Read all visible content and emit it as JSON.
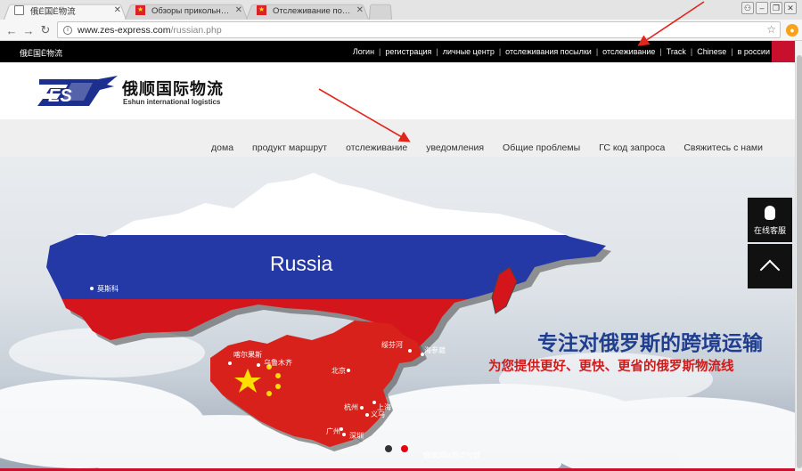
{
  "browser": {
    "tabs": [
      {
        "title": "俄Ё国Ё物流",
        "favicon": "page-icon",
        "active": true
      },
      {
        "title": "Обзоры прикольных и нео",
        "favicon": "vietnam-flag-icon",
        "active": false
      },
      {
        "title": "Отслеживание посылок и",
        "favicon": "vietnam-flag-icon",
        "active": false
      }
    ],
    "url_host": "www.zes-express.com",
    "url_path": "/russian.php"
  },
  "topbar": {
    "brand": "俄Ё国Ё物流",
    "links": [
      "Логин",
      "регистрация",
      "личные центр",
      "отслеживания посылки",
      "отслеживание",
      "Track",
      "Chinese",
      "в россии"
    ]
  },
  "logo": {
    "cn": "俄顺国际物流",
    "en": "Eshun international logistics",
    "mark": "ES"
  },
  "nav": {
    "items": [
      "дома",
      "продукт маршрут",
      "отслеживание",
      "уведомления",
      "Общие проблемы",
      "ГС код запроса",
      "Свяжитесь с нами"
    ]
  },
  "hero": {
    "russia_label": "Russia",
    "cities": {
      "moscow": "莫斯科",
      "urumqi": "乌鲁木齐",
      "xinjiang": "喀尔果斯",
      "suifenhe": "绥芬河",
      "beijing": "北京",
      "shanghai": "上海",
      "hangzhou": "杭州",
      "yiwu": "义乌",
      "guangzhou": "广州",
      "shenzhen": "深圳",
      "vlad": "海参崴"
    },
    "slogan1": "专注对俄罗斯的跨境运输",
    "slogan2": "为您提供更好、更快、更省的俄罗斯物流线",
    "caption": "俄顺国际网点分部"
  },
  "widgets": {
    "qq_label": "在线客服"
  },
  "colors": {
    "russia_white": "#ffffff",
    "russia_blue": "#2438a6",
    "russia_red": "#d4161c",
    "china_red": "#d9211b",
    "star": "#ffde00",
    "brand_red": "#c8102e",
    "arrow_red": "#e1261c"
  }
}
